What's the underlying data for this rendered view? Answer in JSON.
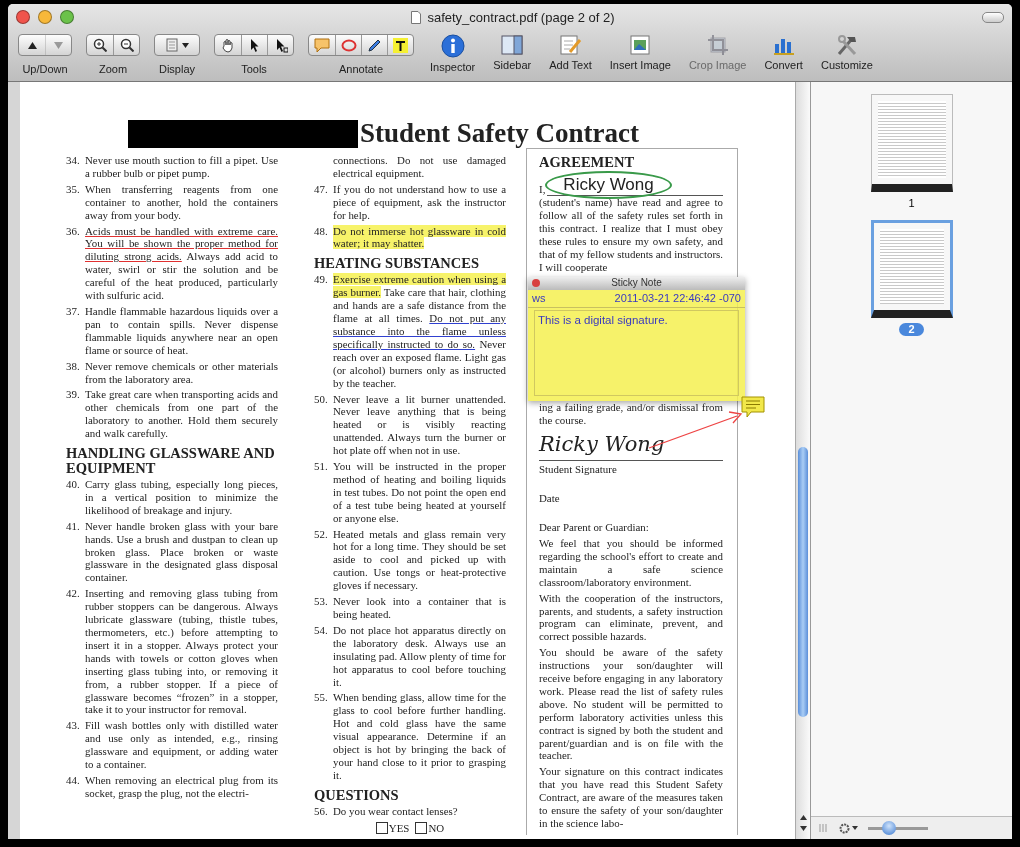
{
  "window": {
    "title": "safety_contract.pdf (page 2 of 2)"
  },
  "toolbar": [
    {
      "kind": "segmented",
      "label": "Up/Down",
      "buttons": [
        {
          "disabled": false
        },
        {
          "disabled": true
        }
      ]
    },
    {
      "kind": "segmented",
      "label": "Zoom",
      "buttons": [
        {
          "disabled": false
        },
        {
          "disabled": false
        }
      ]
    },
    {
      "kind": "dropdown",
      "label": "Display"
    },
    {
      "kind": "segmented",
      "label": "Tools",
      "buttons": [
        {
          "disabled": false
        },
        {
          "disabled": false
        },
        {
          "disabled": false
        }
      ]
    },
    {
      "kind": "segmented",
      "label": "Annotate",
      "buttons": [
        {
          "disabled": false
        },
        {
          "disabled": false
        },
        {
          "disabled": false
        },
        {
          "disabled": false
        }
      ]
    },
    {
      "kind": "icon",
      "label": "Inspector",
      "disabled": false
    },
    {
      "kind": "icon",
      "label": "Sidebar",
      "disabled": false
    },
    {
      "kind": "icon",
      "label": "Add Text",
      "disabled": false
    },
    {
      "kind": "icon",
      "label": "Insert Image",
      "disabled": false
    },
    {
      "kind": "icon",
      "label": "Crop Image",
      "disabled": true
    },
    {
      "kind": "icon",
      "label": "Convert",
      "disabled": false
    },
    {
      "kind": "icon",
      "label": "Customize",
      "disabled": false
    }
  ],
  "document": {
    "title": "Student Safety Contract",
    "columns": [
      {
        "blocks": [
          {
            "kind": "item",
            "number": "34.",
            "text": "Never use mouth suction to fill a pipet. Use a rubber bulb or pipet pump."
          },
          {
            "kind": "item",
            "number": "35.",
            "text": "When transferring reagents from one container to another, hold the containers away from your body."
          },
          {
            "kind": "item",
            "number": "36.",
            "segments": [
              {
                "kind": "red_underline",
                "text": "Acids must be handled with extreme care. You will be shown the proper method for diluting strong acids."
              },
              {
                "kind": "plain",
                "text": " Always add acid to water, swirl or stir the solution and be careful of the heat produced, particularly with sulfuric acid."
              }
            ]
          },
          {
            "kind": "item",
            "number": "37.",
            "text": "Handle flammable hazardous liquids over a pan to contain spills. Never dispense flammable liquids anywhere near an open flame or source of heat."
          },
          {
            "kind": "item",
            "number": "38.",
            "text": "Never remove chemicals or other materials from the laboratory area."
          },
          {
            "kind": "item",
            "number": "39.",
            "text": "Take great care when transporting acids and other chemicals from one part of the laboratory to another. Hold them securely and walk carefully."
          },
          {
            "kind": "heading",
            "text": "HANDLING GLASSWARE AND EQUIPMENT"
          },
          {
            "kind": "item",
            "number": "40.",
            "text": "Carry glass tubing, especially long pieces, in a vertical position to minimize the likelihood of breakage and injury."
          },
          {
            "kind": "item",
            "number": "41.",
            "text": "Never handle broken glass with your bare hands. Use a brush and dustpan to clean up broken glass. Place broken or waste glassware in the designated glass disposal container."
          },
          {
            "kind": "item",
            "number": "42.",
            "text": "Inserting and removing glass tubing from rubber stoppers can be dangerous. Always lubricate glassware (tubing, thistle tubes, thermometers, etc.) before attempting to insert it in a stopper. Always protect your hands with towels or cotton gloves when inserting glass tubing into, or removing it from, a rubber stopper. If a piece of glassware becomes “frozen” in a stopper, take it to your instructor for removal."
          },
          {
            "kind": "item",
            "number": "43.",
            "text": "Fill wash bottles only with distilled water and use only as intended, e.g., rinsing glassware and equipment, or adding water to a container."
          },
          {
            "kind": "item",
            "number": "44.",
            "text": "When removing an electrical plug from its socket, grasp the plug, not the electri-"
          }
        ]
      },
      {
        "blocks": [
          {
            "kind": "item",
            "text": "connections. Do not use damaged electrical equipment."
          },
          {
            "kind": "item",
            "number": "47.",
            "text": "If you do not understand how to use a piece of equipment, ask the instructor for help."
          },
          {
            "kind": "item",
            "number": "48.",
            "segments": [
              {
                "kind": "highlight",
                "text": "Do not immerse hot glassware in cold water; it may shatter."
              }
            ]
          },
          {
            "kind": "heading",
            "text": "HEATING SUBSTANCES"
          },
          {
            "kind": "item",
            "number": "49.",
            "segments": [
              {
                "kind": "highlight",
                "text": "Exercise extreme caution when using a gas burner."
              },
              {
                "kind": "plain",
                "text": " Take care that hair, clothing and hands are a safe distance from the flame at all times. "
              },
              {
                "kind": "blue_underline",
                "text": "Do not put any substance into the flame unless specifically instructed to do so."
              },
              {
                "kind": "plain",
                "text": " Never reach over an exposed flame. Light gas (or alcohol) burners only as instructed by the teacher."
              }
            ]
          },
          {
            "kind": "item",
            "number": "50.",
            "text": "Never leave a lit burner unattended. Never leave anything that is being heated or is visibly reacting unattended. Always turn the burner or hot plate off when not in use."
          },
          {
            "kind": "item",
            "number": "51.",
            "text": "You will be instructed in the proper method of heating and boiling liquids in test tubes. Do not point the open end of a test tube being heated at yourself or anyone else."
          },
          {
            "kind": "item",
            "number": "52.",
            "text": "Heated metals and glass remain very hot for a long time. They should be set aside to cool and picked up with caution. Use tongs or heat-protective gloves if necessary."
          },
          {
            "kind": "item",
            "number": "53.",
            "text": "Never look into a container that is being heated."
          },
          {
            "kind": "item",
            "number": "54.",
            "text": "Do not place hot apparatus directly on the laboratory desk. Always use an insulating pad. Allow plenty of time for hot apparatus to cool before touching it."
          },
          {
            "kind": "item",
            "number": "55.",
            "text": "When bending glass, allow time for the glass to cool before further handling. Hot and cold glass have the same visual appearance. Determine if an object is hot by bringing the back of your hand close to it prior to grasping it."
          },
          {
            "kind": "heading",
            "text": "QUESTIONS"
          },
          {
            "kind": "item",
            "number": "56.",
            "text": "Do you wear contact lenses?"
          },
          {
            "kind": "checkboxes",
            "options": [
              {
                "label": "YES",
                "checked": false
              },
              {
                "label": "NO",
                "checked": false
              }
            ]
          }
        ]
      }
    ],
    "agreement": {
      "heading": "AGREEMENT",
      "name_prefix": "I,",
      "name_value": "Ricky Wong",
      "text_before": "(student's name) have read and agree to follow all of the safety rules set forth in this contract. I realize that I must obey these rules to ensure my own safety, and that of my fellow students and instructors. I will cooperate",
      "sticky_note": {
        "title": "Sticky Note",
        "author": "ws",
        "timestamp": "2011-03-21 22:46:42 -070",
        "body": "This is a digital signature."
      },
      "text_after": "ing a failing grade, and/or dismissal from the course.",
      "signature": "Ricky Wong",
      "signature_label": "Student Signature",
      "date_label": "Date",
      "salutation": "Dear Parent or Guardian:",
      "paragraphs": [
        "We feel that you should be informed regarding the school's effort to create and maintain a safe science classroom/laboratory environment.",
        "With the cooperation of the instructors, parents, and students, a safety instruction program can eliminate, prevent, and correct possible hazards.",
        "You should be aware of the safety instructions your son/daughter will receive before engaging in any laboratory work. Please read the list of safety rules above. No student will be permitted to perform laboratory activities unless this contract is signed by both the student and parent/guardian and is on file with the teacher.",
        "Your signature on this contract indicates that you have read this Student Safety Contract, are aware of the measures taken to ensure the safety of your son/daughter in the science labo-"
      ]
    }
  },
  "sidebar": {
    "thumbnails": [
      {
        "label": "1",
        "selected": false
      },
      {
        "label": "2",
        "selected": true
      }
    ],
    "zoom": {
      "level": 0.3
    }
  }
}
